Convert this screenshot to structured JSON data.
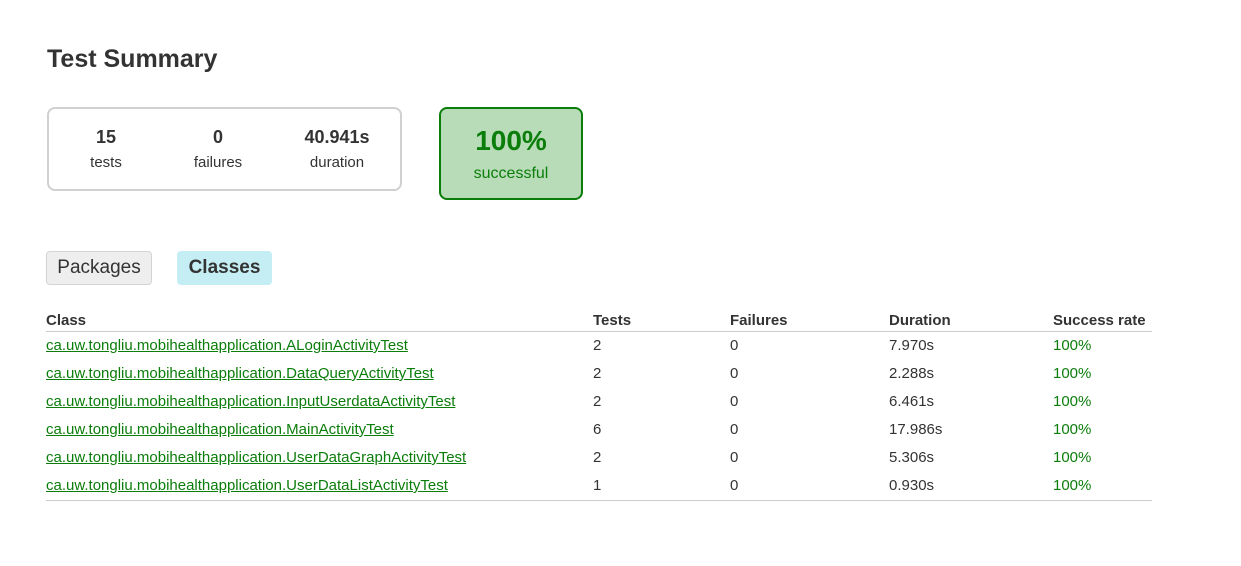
{
  "page": {
    "title": "Test Summary"
  },
  "summary": {
    "tests": {
      "value": "15",
      "label": "tests"
    },
    "failures": {
      "value": "0",
      "label": "failures"
    },
    "duration": {
      "value": "40.941s",
      "label": "duration"
    },
    "success": {
      "value": "100%",
      "label": "successful"
    }
  },
  "tabs": [
    {
      "label": "Packages",
      "selected": false
    },
    {
      "label": "Classes",
      "selected": true
    }
  ],
  "table": {
    "headers": [
      "Class",
      "Tests",
      "Failures",
      "Duration",
      "Success rate"
    ],
    "rows": [
      {
        "class": "ca.uw.tongliu.mobihealthapplication.ALoginActivityTest",
        "tests": "2",
        "failures": "0",
        "duration": "7.970s",
        "rate": "100%"
      },
      {
        "class": "ca.uw.tongliu.mobihealthapplication.DataQueryActivityTest",
        "tests": "2",
        "failures": "0",
        "duration": "2.288s",
        "rate": "100%"
      },
      {
        "class": "ca.uw.tongliu.mobihealthapplication.InputUserdataActivityTest",
        "tests": "2",
        "failures": "0",
        "duration": "6.461s",
        "rate": "100%"
      },
      {
        "class": "ca.uw.tongliu.mobihealthapplication.MainActivityTest",
        "tests": "6",
        "failures": "0",
        "duration": "17.986s",
        "rate": "100%"
      },
      {
        "class": "ca.uw.tongliu.mobihealthapplication.UserDataGraphActivityTest",
        "tests": "2",
        "failures": "0",
        "duration": "5.306s",
        "rate": "100%"
      },
      {
        "class": "ca.uw.tongliu.mobihealthapplication.UserDataListActivityTest",
        "tests": "1",
        "failures": "0",
        "duration": "0.930s",
        "rate": "100%"
      }
    ]
  },
  "colors": {
    "success": "#0a7d0a",
    "success_bg": "#b8dcb8",
    "selected_tab_bg": "#c5eef4"
  }
}
